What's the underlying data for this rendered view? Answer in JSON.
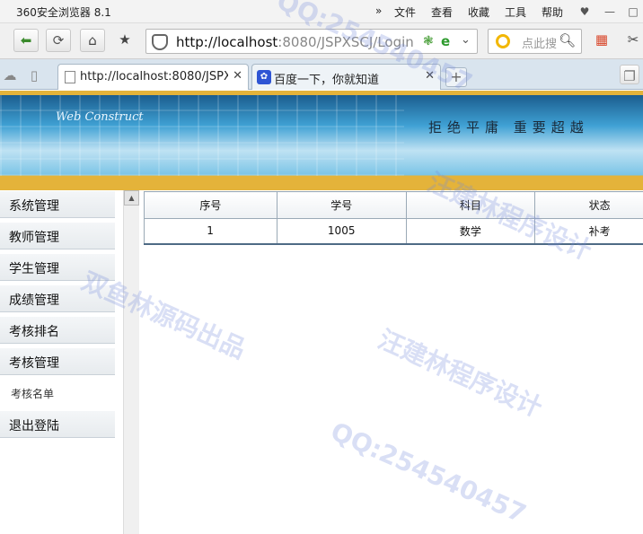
{
  "browser": {
    "title": "360安全浏览器 8.1",
    "menu": [
      "文件",
      "查看",
      "收藏",
      "工具",
      "帮助"
    ],
    "url_host": "http://localhost",
    "url_rest": ":8080/JSPXSCJ/Login",
    "search_placeholder": "点此搜",
    "tabs": [
      {
        "label": "http://localhost:8080/JSPXSC"
      },
      {
        "label": "百度一下，你就知道"
      }
    ]
  },
  "banner": {
    "web_text": "Web Construct",
    "slogan": "拒绝平庸 重要超越"
  },
  "sidebar": {
    "items": [
      "系统管理",
      "教师管理",
      "学生管理",
      "成绩管理",
      "考核排名",
      "考核管理"
    ],
    "sub_item": "考核名单",
    "logout": "退出登陆"
  },
  "table": {
    "headers": [
      "序号",
      "学号",
      "科目",
      "状态"
    ],
    "rows": [
      [
        "1",
        "1005",
        "数学",
        "补考"
      ]
    ]
  },
  "watermarks": [
    "QQ:254540457",
    "双鱼林源码出品",
    "汪建林程序设计",
    "QQ:254540457",
    "汪建林程序设计"
  ]
}
